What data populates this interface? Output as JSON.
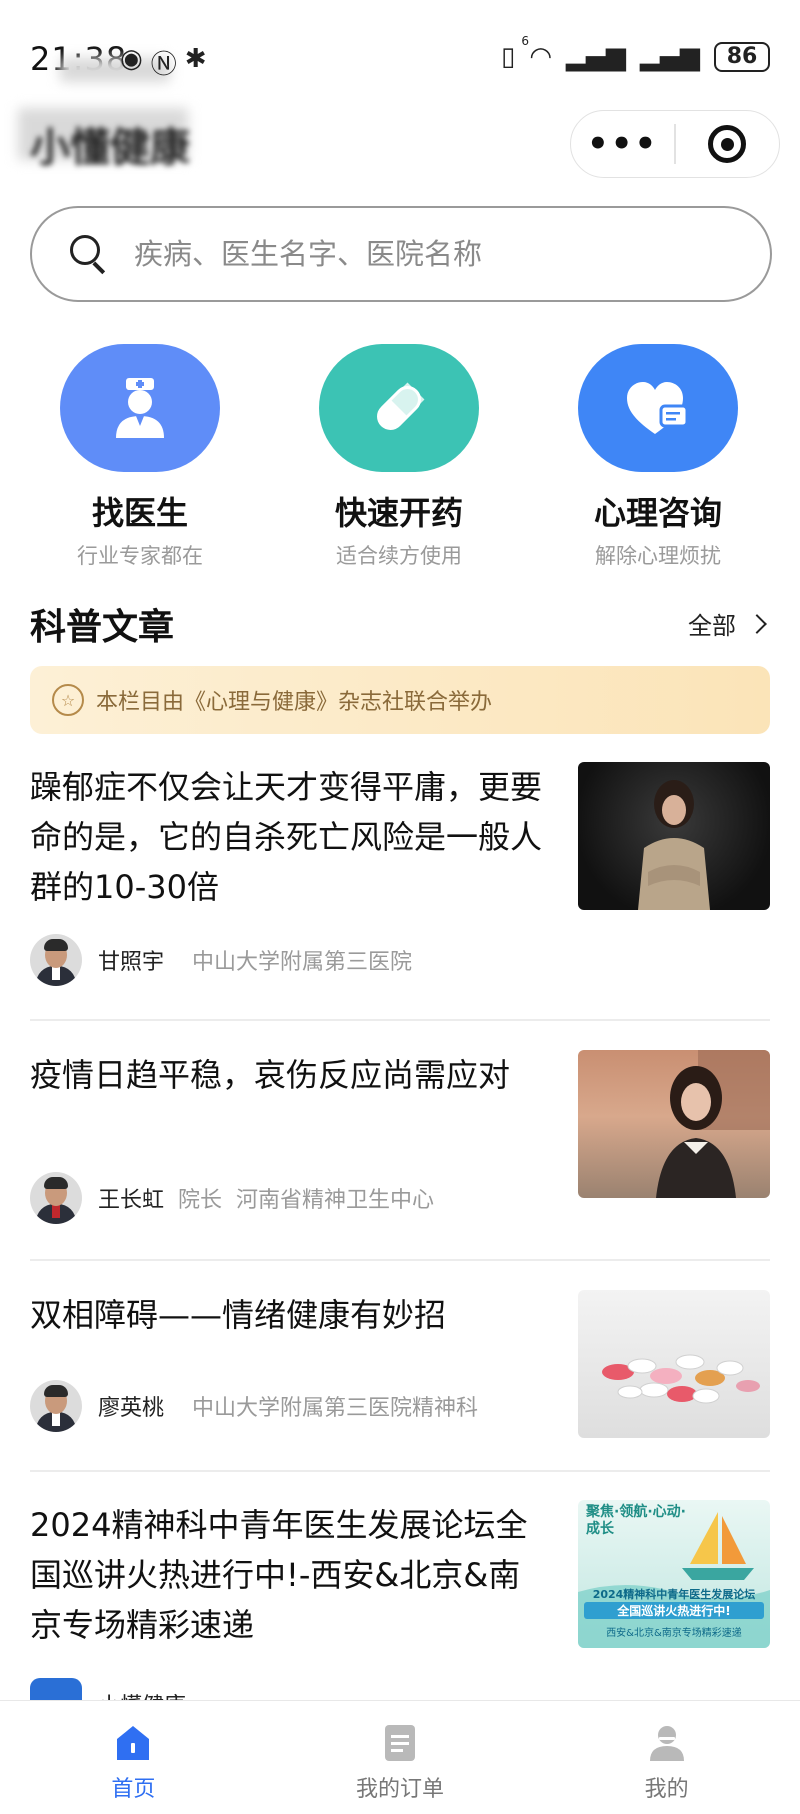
{
  "status_bar": {
    "time": "21:38",
    "left_icons": [
      "eye-icon",
      "nfc-icon",
      "bluetooth-icon"
    ],
    "right_icons": [
      "vibrate-icon",
      "wifi-icon",
      "signal-icon",
      "signal-icon"
    ],
    "wifi_badge": "6",
    "battery": "86"
  },
  "header": {
    "app_title": "小懂健康",
    "capsule_more": "•••"
  },
  "search": {
    "placeholder": "疾病、医生名字、医院名称"
  },
  "services": [
    {
      "title": "找医生",
      "subtitle": "行业专家都在",
      "icon": "doctor-icon",
      "color": "#5f8df8"
    },
    {
      "title": "快速开药",
      "subtitle": "适合续方使用",
      "icon": "pill-icon",
      "color": "#3cc3b4"
    },
    {
      "title": "心理咨询",
      "subtitle": "解除心理烦扰",
      "icon": "heart-chat-icon",
      "color": "#3f86f6"
    }
  ],
  "section": {
    "title": "科普文章",
    "see_all": "全部",
    "banner": "本栏目由《心理与健康》杂志社联合举办"
  },
  "articles": [
    {
      "title": "躁郁症不仅会让天才变得平庸，更要命的是，它的自杀死亡风险是一般人群的10-30倍",
      "author": "甘照宇",
      "role": "",
      "org": "中山大学附属第三医院"
    },
    {
      "title": "疫情日趋平稳，哀伤反应尚需应对",
      "author": "王长虹",
      "role": "院长",
      "org": "河南省精神卫生中心"
    },
    {
      "title": "双相障碍——情绪健康有妙招",
      "author": "廖英桃",
      "role": "",
      "org": "中山大学附属第三医院精神科"
    },
    {
      "title": "2024精神科中青年医生发展论坛全国巡讲火热进行中!-西安&北京&南京专场精彩速递",
      "author": "小懂健康",
      "role": "",
      "org": "",
      "thumb_heading": "聚焦·领航·心动·成长",
      "thumb_text": "2024精神科中青年医生发展论坛",
      "thumb_text2": "全国巡讲火热进行中!",
      "thumb_text3": "西安&北京&南京专场精彩速递"
    }
  ],
  "bottom_nav": [
    {
      "label": "首页",
      "icon": "home-icon",
      "active": true
    },
    {
      "label": "我的订单",
      "icon": "order-icon",
      "active": false
    },
    {
      "label": "我的",
      "icon": "profile-icon",
      "active": false
    }
  ]
}
